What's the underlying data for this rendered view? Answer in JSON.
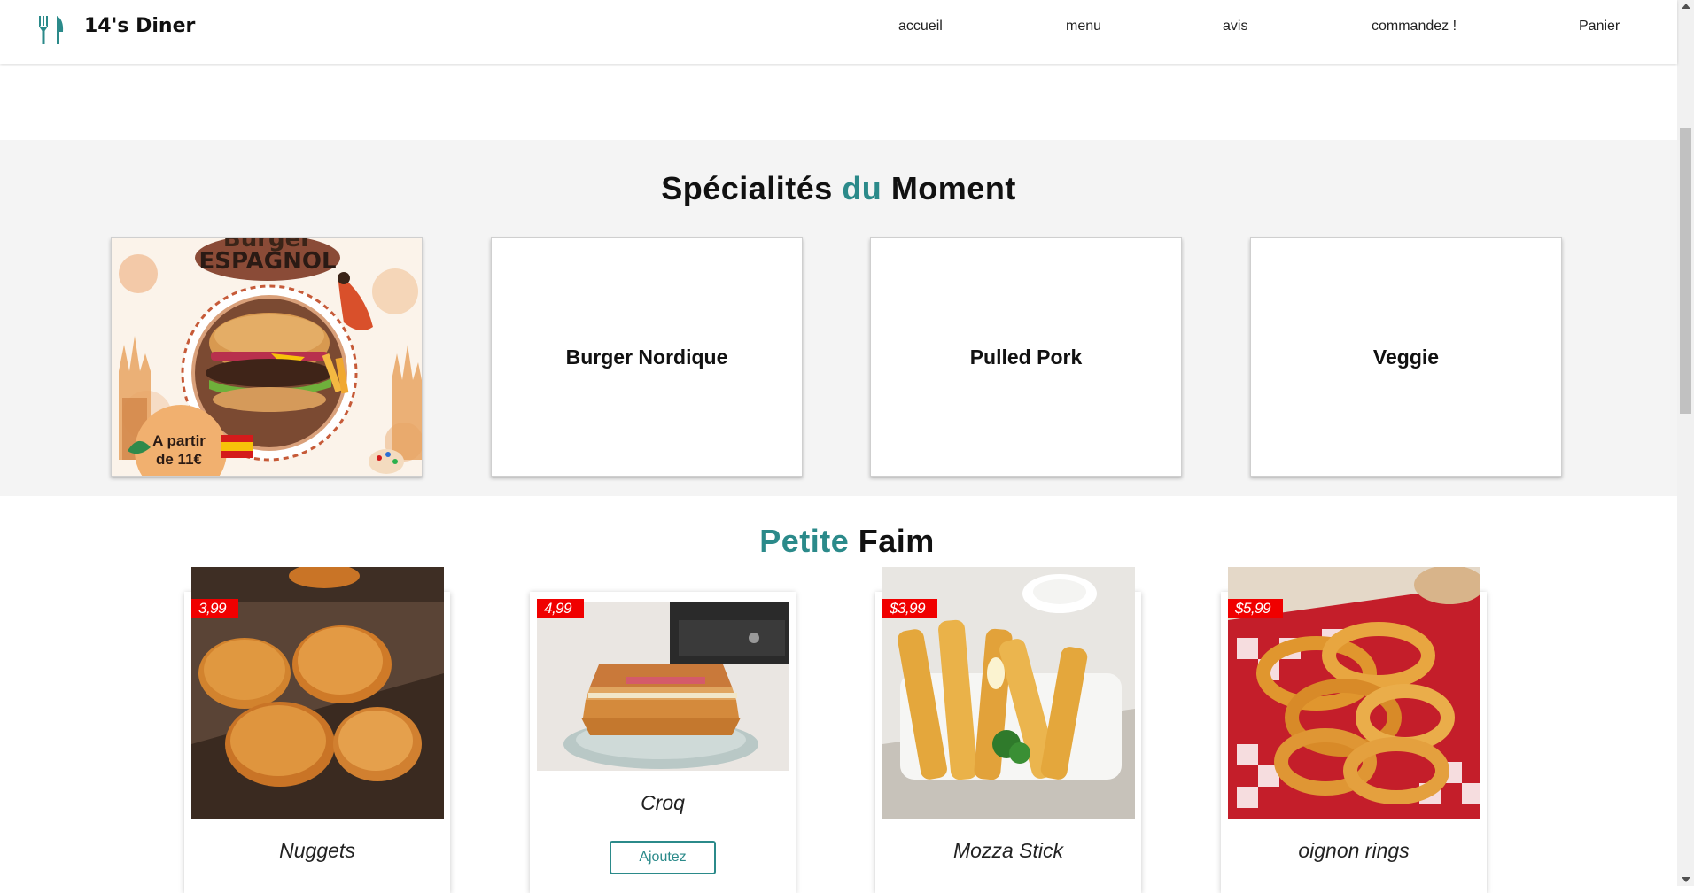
{
  "header": {
    "brand": "14's Diner",
    "nav": [
      "accueil",
      "menu",
      "avis",
      "commandez !",
      "Panier"
    ]
  },
  "specials": {
    "title_part1": "Spécialités",
    "title_part2": "du",
    "title_part3": "Moment",
    "poster": {
      "line1": "Burger",
      "line2": "ESPAGNOL",
      "price_line1": "A partir",
      "price_line2": "de 11€"
    },
    "items": [
      "Burger Nordique",
      "Pulled Pork",
      "Veggie"
    ]
  },
  "petite_faim": {
    "title_part1": "Petite",
    "title_part2": "Faim",
    "items": [
      {
        "name": "Nuggets",
        "price": "3,99"
      },
      {
        "name": "Croq",
        "price": "4,99",
        "button": "Ajoutez"
      },
      {
        "name": "Mozza Stick",
        "price": "$3,99"
      },
      {
        "name": "oignon rings",
        "price": "$5,99"
      }
    ]
  },
  "colors": {
    "accent": "#2b8a8a",
    "price_tag": "#f00000",
    "section_bg": "#f4f4f4"
  }
}
